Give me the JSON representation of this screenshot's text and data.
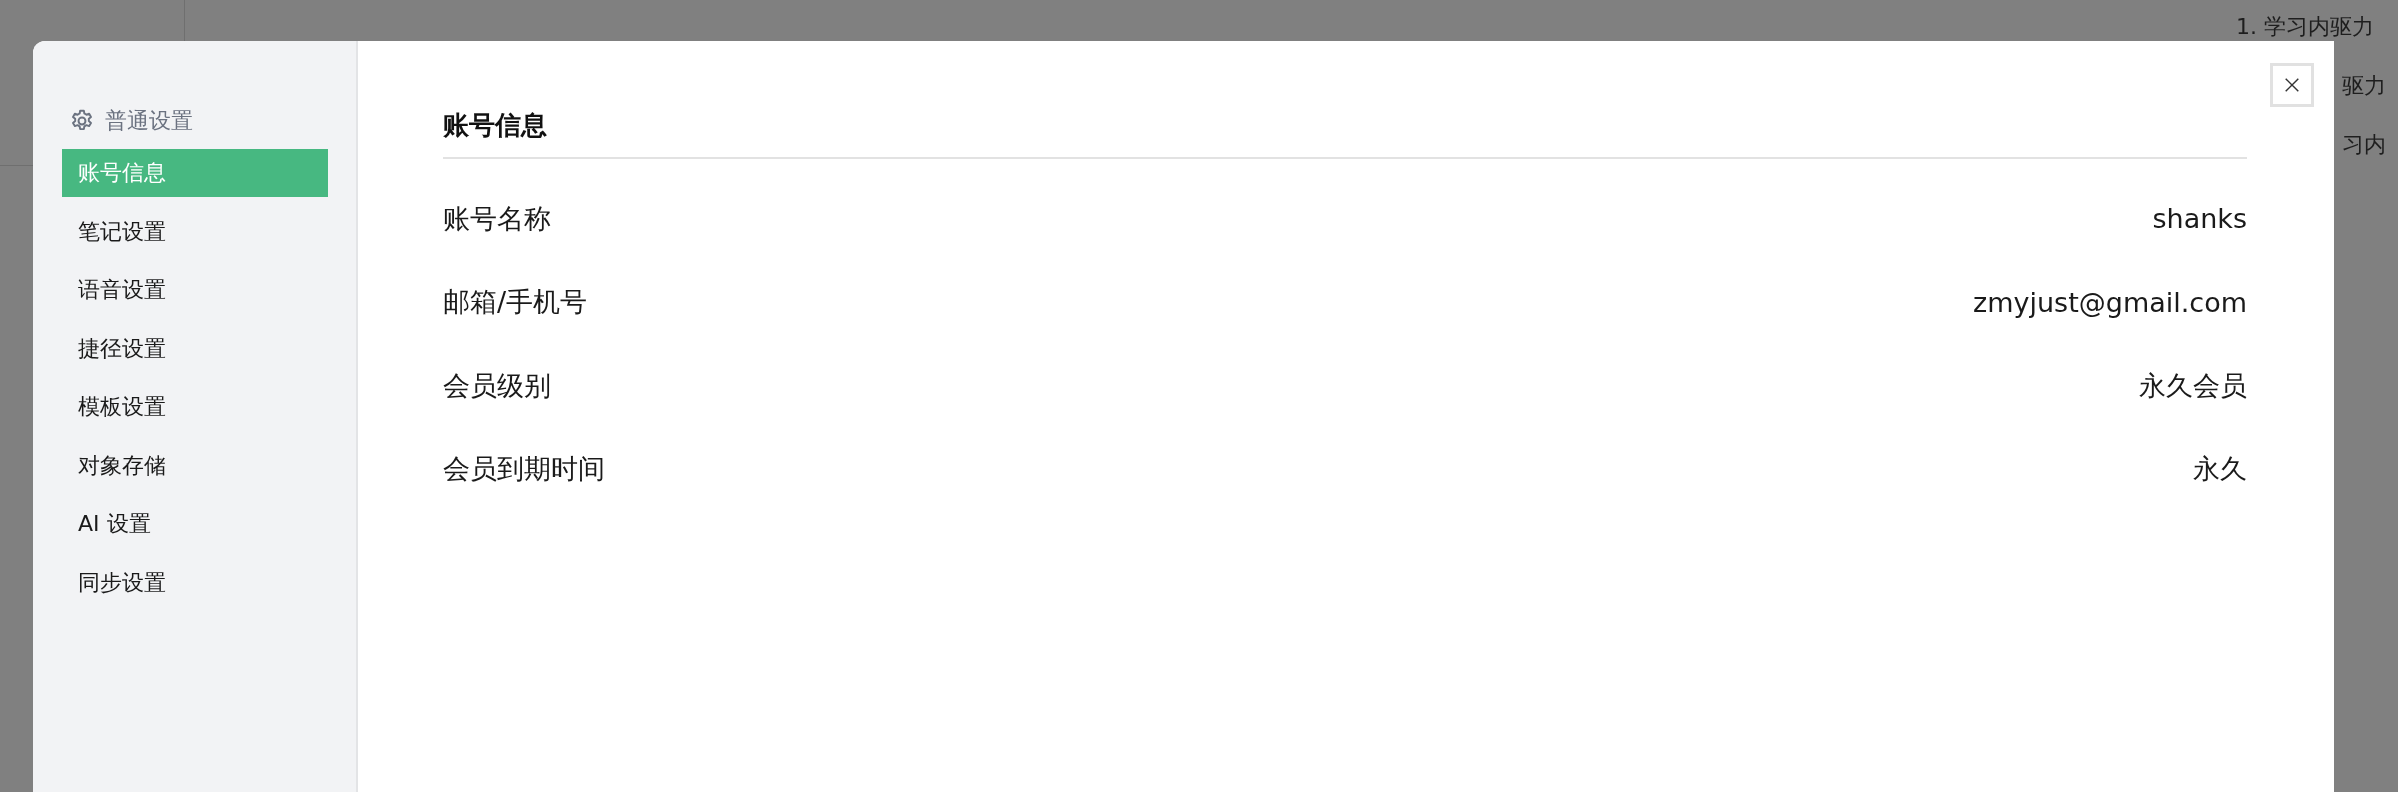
{
  "background": {
    "lines": [
      "1. 学习内驱力",
      "驱力",
      "习内"
    ]
  },
  "sidebar": {
    "group": "普通设置",
    "items": [
      {
        "label": "账号信息",
        "selected": true
      },
      {
        "label": "笔记设置",
        "selected": false
      },
      {
        "label": "语音设置",
        "selected": false
      },
      {
        "label": "捷径设置",
        "selected": false
      },
      {
        "label": "模板设置",
        "selected": false
      },
      {
        "label": "对象存储",
        "selected": false
      },
      {
        "label": "AI 设置",
        "selected": false
      },
      {
        "label": "同步设置",
        "selected": false
      }
    ]
  },
  "content": {
    "title": "账号信息",
    "rows": [
      {
        "label": "账号名称",
        "value": "shanks"
      },
      {
        "label": "邮箱/手机号",
        "value": "zmyjust@gmail.com"
      },
      {
        "label": "会员级别",
        "value": "永久会员"
      },
      {
        "label": "会员到期时间",
        "value": "永久"
      }
    ]
  }
}
